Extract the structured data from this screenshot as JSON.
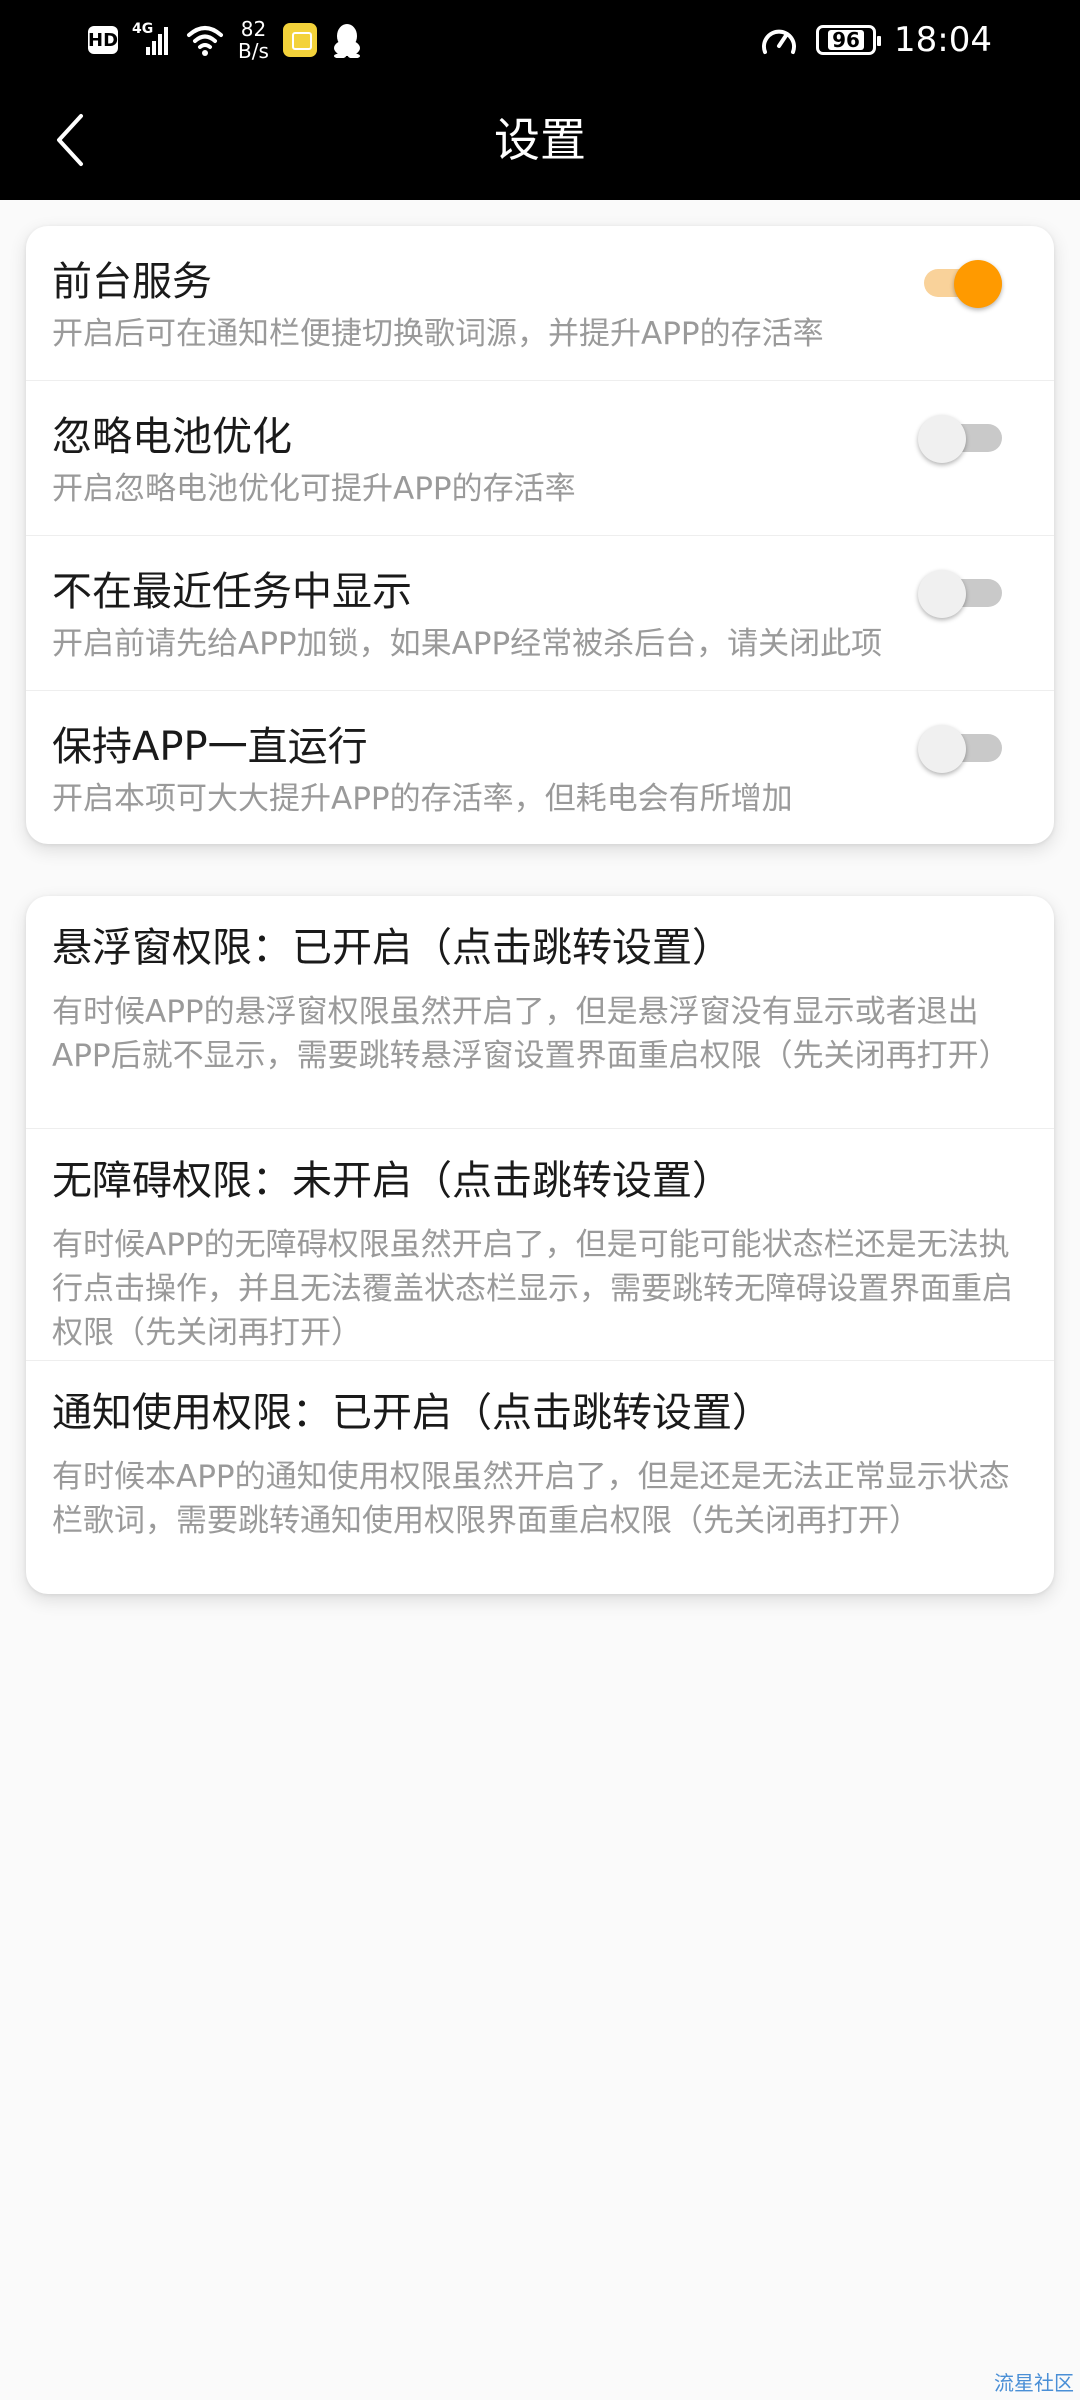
{
  "status_bar": {
    "hd_label": "HD",
    "network_type": "4G",
    "net_speed_value": "82",
    "net_speed_unit": "B/s",
    "battery_level": "96",
    "time": "18:04"
  },
  "app_bar": {
    "title": "设置"
  },
  "card1": {
    "rows": [
      {
        "title": "前台服务",
        "desc": "开启后可在通知栏便捷切换歌词源，并提升APP的存活率",
        "enabled": true
      },
      {
        "title": "忽略电池优化",
        "desc": "开启忽略电池优化可提升APP的存活率",
        "enabled": false
      },
      {
        "title": "不在最近任务中显示",
        "desc": "开启前请先给APP加锁，如果APP经常被杀后台，请关闭此项",
        "enabled": false
      },
      {
        "title": "保持APP一直运行",
        "desc": "开启本项可大大提升APP的存活率，但耗电会有所增加",
        "enabled": false
      }
    ]
  },
  "card2": {
    "rows": [
      {
        "title": "悬浮窗权限：已开启（点击跳转设置）",
        "desc": "有时候APP的悬浮窗权限虽然开启了，但是悬浮窗没有显示或者退出APP后就不显示，需要跳转悬浮窗设置界面重启权限（先关闭再打开）"
      },
      {
        "title": "无障碍权限：未开启（点击跳转设置）",
        "desc": "有时候APP的无障碍权限虽然开启了，但是可能可能状态栏还是无法执行点击操作，并且无法覆盖状态栏显示，需要跳转无障碍设置界面重启权限（先关闭再打开）"
      },
      {
        "title": "通知使用权限：已开启（点击跳转设置）",
        "desc": "有时候本APP的通知使用权限虽然开启了，但是还是无法正常显示状态栏歌词，需要跳转通知使用权限界面重启权限（先关闭再打开）"
      }
    ]
  },
  "watermark": "流星社区",
  "colors": {
    "accent": "#ff9a00",
    "accent_track": "#f9d29a"
  }
}
